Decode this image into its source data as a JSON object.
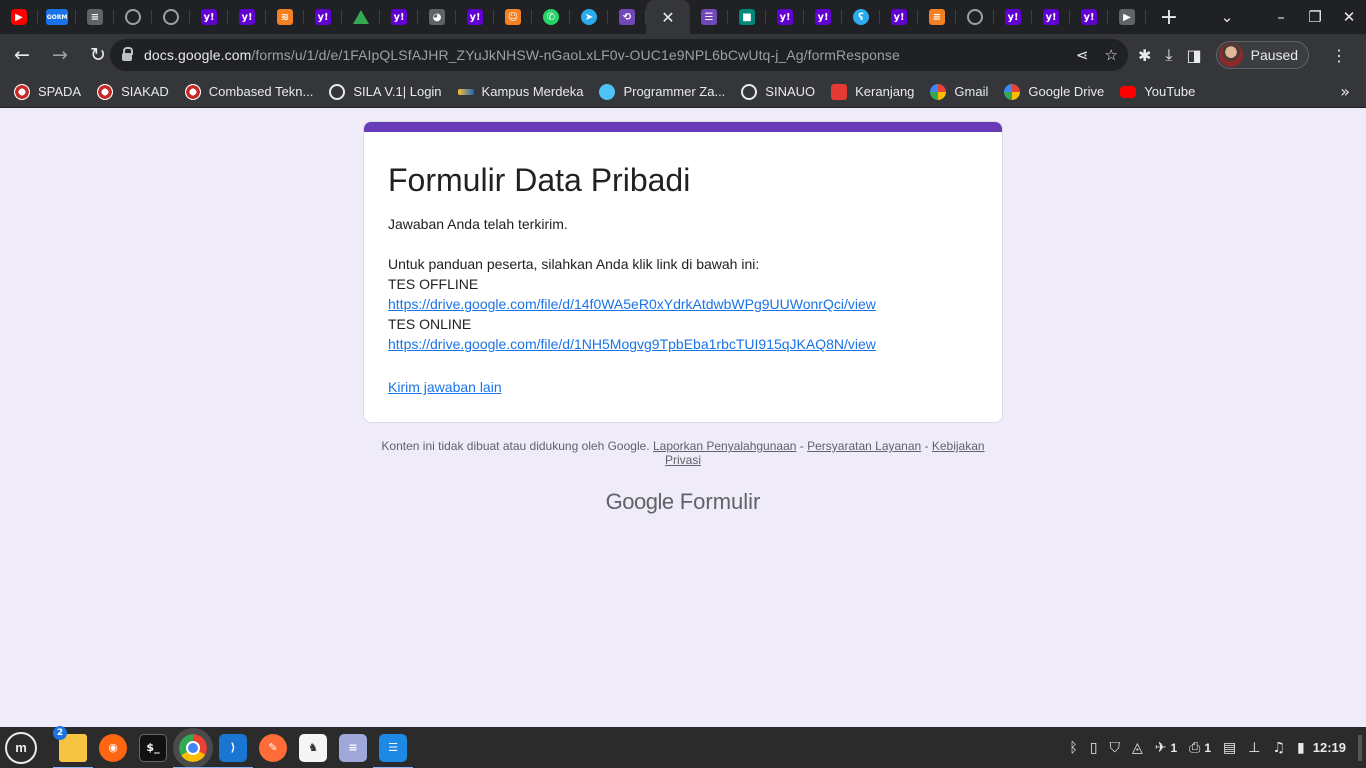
{
  "browser": {
    "tabs": [
      {
        "icon": "youtube-icon",
        "glyph": "▶",
        "cls": "t-yt"
      },
      {
        "icon": "gorm-icon",
        "glyph": "GORM",
        "cls": "t-gorm"
      },
      {
        "icon": "go-icon",
        "glyph": "≡",
        "cls": "t-grey"
      },
      {
        "icon": "globe-icon",
        "glyph": "",
        "cls": "t-globe"
      },
      {
        "icon": "globe-icon",
        "glyph": "",
        "cls": "t-globe"
      },
      {
        "icon": "yahoo-icon",
        "glyph": "y!",
        "cls": "t-y"
      },
      {
        "icon": "yahoo-icon",
        "glyph": "y!",
        "cls": "t-y"
      },
      {
        "icon": "colored-bars-icon",
        "glyph": "≋",
        "cls": "t-so"
      },
      {
        "icon": "yahoo-icon",
        "glyph": "y!",
        "cls": "t-y"
      },
      {
        "icon": "google-drive-icon",
        "glyph": "",
        "cls": "t-drive"
      },
      {
        "icon": "yahoo-icon",
        "glyph": "y!",
        "cls": "t-y"
      },
      {
        "icon": "lemon-icon",
        "glyph": "◕",
        "cls": "t-grey"
      },
      {
        "icon": "yahoo-icon",
        "glyph": "y!",
        "cls": "t-y"
      },
      {
        "icon": "avatar-site-icon",
        "glyph": "☺",
        "cls": "t-so"
      },
      {
        "icon": "whatsapp-icon",
        "glyph": "✆",
        "cls": "t-wa"
      },
      {
        "icon": "telegram-icon",
        "glyph": "➤",
        "cls": "t-tg"
      },
      {
        "icon": "sync-icon",
        "glyph": "⟲",
        "cls": "t-forms"
      }
    ],
    "active_tab": {
      "icon": "close-icon",
      "glyph": "✕"
    },
    "tabs_after": [
      {
        "icon": "google-forms-icon",
        "glyph": "☰",
        "cls": "t-forms"
      },
      {
        "icon": "google-meet-icon",
        "glyph": "■",
        "cls": "t-meet"
      },
      {
        "icon": "yahoo-icon",
        "glyph": "y!",
        "cls": "t-y"
      },
      {
        "icon": "yahoo-icon",
        "glyph": "y!",
        "cls": "t-y"
      },
      {
        "icon": "gopher-icon",
        "glyph": "ʕ",
        "cls": "t-tg"
      },
      {
        "icon": "yahoo-icon",
        "glyph": "y!",
        "cls": "t-y"
      },
      {
        "icon": "stack-overflow-icon",
        "glyph": "≡",
        "cls": "t-so"
      },
      {
        "icon": "globe-icon",
        "glyph": "",
        "cls": "t-globe"
      },
      {
        "icon": "yahoo-icon",
        "glyph": "y!",
        "cls": "t-y"
      },
      {
        "icon": "yahoo-icon",
        "glyph": "y!",
        "cls": "t-y"
      },
      {
        "icon": "yahoo-icon",
        "glyph": "y!",
        "cls": "t-y"
      },
      {
        "icon": "play-flag-icon",
        "glyph": "▶",
        "cls": "t-grey"
      }
    ],
    "new_tab_glyph": "+",
    "window_controls": [
      "–",
      "❐",
      "✕"
    ],
    "address": {
      "host": "docs.google.com",
      "path": "/forms/u/1/d/e/1FAIpQLSfAJHR_ZYuJkNHSW-nGaoLxLF0v-OUC1e9NPL6bCwUtq-j_Ag/formResponse"
    },
    "profile_label": "Paused",
    "bookmarks": [
      {
        "label": "SPADA",
        "icon": "university-seal-icon",
        "cls": "bi-uni"
      },
      {
        "label": "SIAKAD",
        "icon": "university-seal-icon",
        "cls": "bi-uni"
      },
      {
        "label": "Combased Tekn...",
        "icon": "university-seal-icon",
        "cls": "bi-uni"
      },
      {
        "label": "SILA V.1| Login",
        "icon": "globe-icon",
        "cls": "bi-globe"
      },
      {
        "label": "Kampus Merdeka",
        "icon": "kampus-merdeka-icon",
        "cls": "bi-kampus"
      },
      {
        "label": "Programmer Za...",
        "icon": "programmer-zaman-now-icon",
        "cls": "bi-prog"
      },
      {
        "label": "SINAUO",
        "icon": "globe-icon",
        "cls": "bi-globe"
      },
      {
        "label": "Keranjang",
        "icon": "cart-icon",
        "cls": "bi-ker"
      },
      {
        "label": "Gmail",
        "icon": "google-icon",
        "cls": "bi-g"
      },
      {
        "label": "Google Drive",
        "icon": "google-icon",
        "cls": "bi-g"
      },
      {
        "label": "YouTube",
        "icon": "youtube-icon",
        "cls": "bi-yt"
      }
    ]
  },
  "form": {
    "title": "Formulir Data Pribadi",
    "confirmation": "Jawaban Anda telah terkirim.",
    "intro": "Untuk panduan peserta, silahkan Anda klik link di bawah ini:",
    "offline_label": "TES OFFLINE",
    "offline_link": "https://drive.google.com/file/d/14f0WA5eR0xYdrkAtdwbWPg9UUWonrQci/view",
    "online_label": "TES ONLINE",
    "online_link": "https://drive.google.com/file/d/1NH5Mogvg9TpbEba1rbcTUI915qJKAQ8N/view",
    "another_response": "Kirim jawaban lain"
  },
  "footer": {
    "disclaimer": "Konten ini tidak dibuat atau didukung oleh Google.",
    "report_abuse": "Laporkan Penyalahgunaan",
    "terms": "Persyaratan Layanan",
    "privacy": "Kebijakan Privasi",
    "separator": " - ",
    "brand_google": "Google",
    "brand_forms": "Formulir"
  },
  "taskbar": {
    "menu_glyph": "m",
    "apps": [
      {
        "name": "files-app",
        "glyph": "",
        "cls": "a-files",
        "running": true,
        "badge": "2"
      },
      {
        "name": "firefox-app",
        "glyph": "◉",
        "cls": "a-firefox",
        "running": false
      },
      {
        "name": "terminal-app",
        "glyph": "$_",
        "cls": "a-term",
        "running": false
      },
      {
        "name": "chrome-app",
        "glyph": "",
        "cls": "a-chrome",
        "running": true,
        "focused": true
      },
      {
        "name": "vscode-app",
        "glyph": "⟩",
        "cls": "a-vscode",
        "running": true
      },
      {
        "name": "postman-app",
        "glyph": "✎",
        "cls": "a-postman",
        "running": false
      },
      {
        "name": "dbeaver-app",
        "glyph": "♞",
        "cls": "a-beaver",
        "running": false
      },
      {
        "name": "text-editor-app",
        "glyph": "≡",
        "cls": "a-text",
        "running": false
      },
      {
        "name": "docs-app",
        "glyph": "☰",
        "cls": "a-docs",
        "running": true
      }
    ],
    "tray": [
      {
        "name": "bluetooth-icon",
        "glyph": "ᛒ"
      },
      {
        "name": "clipboard-icon",
        "glyph": "▯"
      },
      {
        "name": "shield-icon",
        "glyph": "⛉"
      },
      {
        "name": "network-icon",
        "glyph": "◬"
      },
      {
        "name": "notification-icon",
        "glyph": "✈",
        "count": "1"
      },
      {
        "name": "printer-icon",
        "glyph": "⎙",
        "count": "1"
      },
      {
        "name": "document-icon",
        "glyph": "▤"
      },
      {
        "name": "network-tree-icon",
        "glyph": "⊥"
      },
      {
        "name": "sound-icon",
        "glyph": "♫"
      },
      {
        "name": "battery-icon",
        "glyph": "▮"
      }
    ],
    "clock": "12:19"
  }
}
